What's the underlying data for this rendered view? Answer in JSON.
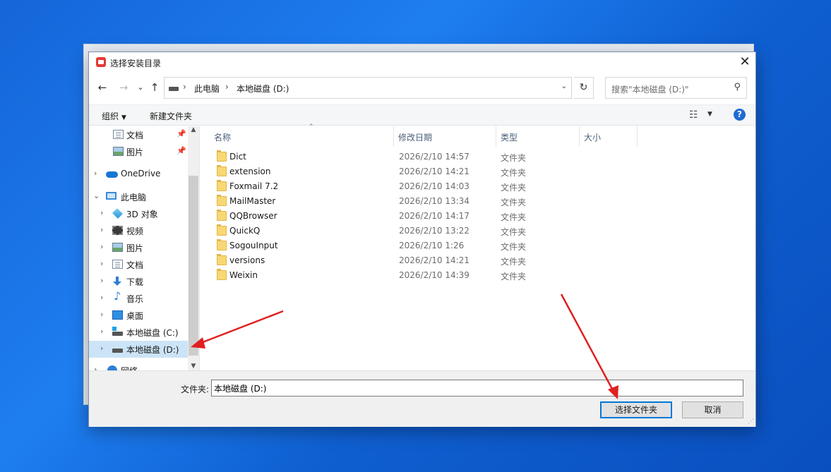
{
  "dialog": {
    "title": "选择安装目录",
    "close_glyph": "✕"
  },
  "nav": {
    "back_glyph": "←",
    "forward_glyph": "→",
    "recent_glyph": "⌄",
    "up_glyph": "↑",
    "breadcrumb": [
      "此电脑",
      "本地磁盘 (D:)"
    ],
    "breadcrumb_sep": "›",
    "dropdown_glyph": "⌄",
    "refresh_glyph": "↻"
  },
  "search": {
    "placeholder": "搜索\"本地磁盘 (D:)\"",
    "icon_glyph": "⚲"
  },
  "toolbar": {
    "organize_label": "组织",
    "organize_caret": "▼",
    "new_folder_label": "新建文件夹",
    "view_glyph": "☷",
    "view_caret": "▼",
    "help_glyph": "?"
  },
  "tree": [
    {
      "label": "文档",
      "icon": "documents-icon",
      "chev": "",
      "pinned": true
    },
    {
      "label": "图片",
      "icon": "pictures-icon",
      "chev": "",
      "pinned": true
    },
    {
      "label": "OneDrive",
      "icon": "onedrive-icon",
      "chev": "›",
      "pinned": false
    },
    {
      "label": "此电脑",
      "icon": "this-pc-icon",
      "chev": "⌄",
      "pinned": false
    },
    {
      "label": "3D 对象",
      "icon": "3d-objects-icon",
      "chev": "›",
      "pinned": false
    },
    {
      "label": "视频",
      "icon": "videos-icon",
      "chev": "›",
      "pinned": false
    },
    {
      "label": "图片",
      "icon": "pictures-icon",
      "chev": "›",
      "pinned": false
    },
    {
      "label": "文档",
      "icon": "documents-icon",
      "chev": "›",
      "pinned": false
    },
    {
      "label": "下载",
      "icon": "downloads-icon",
      "chev": "›",
      "pinned": false
    },
    {
      "label": "音乐",
      "icon": "music-icon",
      "chev": "›",
      "pinned": false
    },
    {
      "label": "桌面",
      "icon": "desktop-icon",
      "chev": "›",
      "pinned": false
    },
    {
      "label": "本地磁盘 (C:)",
      "icon": "drive-c-icon",
      "chev": "›",
      "pinned": false
    },
    {
      "label": "本地磁盘 (D:)",
      "icon": "drive-d-icon",
      "chev": "›",
      "pinned": false,
      "selected": true
    },
    {
      "label": "网络",
      "icon": "network-icon",
      "chev": "›",
      "pinned": false
    }
  ],
  "pin_glyph": "📌",
  "scroll": {
    "up_glyph": "▲",
    "down_glyph": "▼"
  },
  "columns": {
    "name": "名称",
    "modified": "修改日期",
    "type": "类型",
    "size": "大小",
    "sort_glyph": "⌃"
  },
  "files": [
    {
      "name": "Dict",
      "modified": "2026/2/10 14:57",
      "type": "文件夹"
    },
    {
      "name": "extension",
      "modified": "2026/2/10 14:21",
      "type": "文件夹"
    },
    {
      "name": "Foxmail 7.2",
      "modified": "2026/2/10 14:03",
      "type": "文件夹"
    },
    {
      "name": "MailMaster",
      "modified": "2026/2/10 13:34",
      "type": "文件夹"
    },
    {
      "name": "QQBrowser",
      "modified": "2026/2/10 14:17",
      "type": "文件夹"
    },
    {
      "name": "QuickQ",
      "modified": "2026/2/10 13:22",
      "type": "文件夹"
    },
    {
      "name": "SogouInput",
      "modified": "2026/2/10 1:26",
      "type": "文件夹"
    },
    {
      "name": "versions",
      "modified": "2026/2/10 14:21",
      "type": "文件夹"
    },
    {
      "name": "Weixin",
      "modified": "2026/2/10 14:39",
      "type": "文件夹"
    }
  ],
  "bottom": {
    "folder_label": "文件夹:",
    "folder_value": "本地磁盘 (D:)",
    "select_button": "选择文件夹",
    "cancel_button": "取消",
    "grip_glyph": "⋰"
  },
  "colors": {
    "selected_bg": "#cce4f7",
    "accent": "#0078d7",
    "arrow": "#e02020"
  }
}
